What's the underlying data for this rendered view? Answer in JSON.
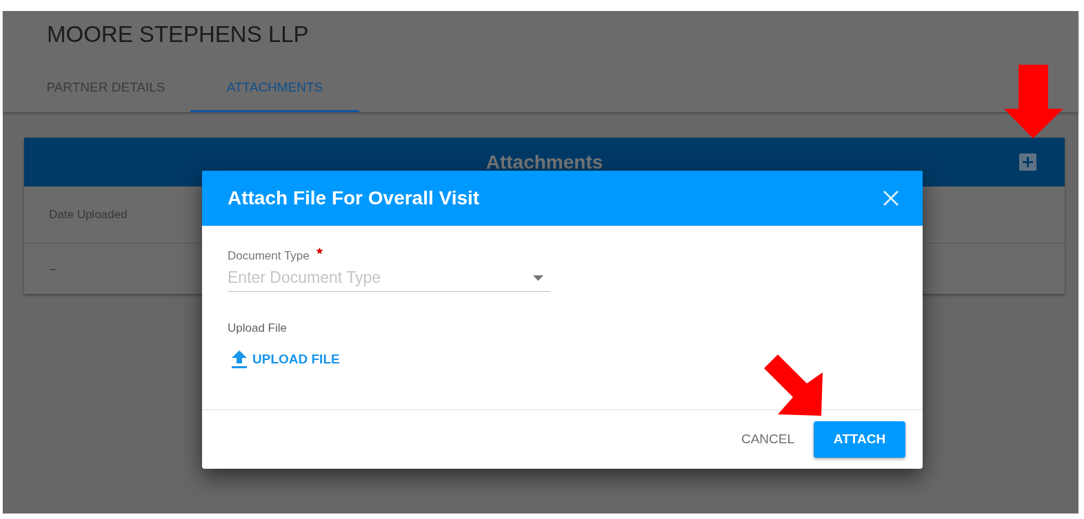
{
  "page_title": "MOORE STEPHENS LLP",
  "tabs": [
    {
      "label": "PARTNER DETAILS",
      "selected": false
    },
    {
      "label": "ATTACHMENTS",
      "selected": true
    }
  ],
  "attachments_card": {
    "title": "Attachments",
    "table": {
      "columns": [
        "Date Uploaded"
      ],
      "rows": [
        [
          "–"
        ]
      ]
    }
  },
  "dialog": {
    "title": "Attach File For Overall Visit",
    "fields": [
      {
        "kind": "select",
        "label": "Document Type",
        "required": true,
        "placeholder": "Enter Document Type"
      },
      {
        "kind": "upload",
        "label": "Upload File",
        "button": "UPLOAD FILE"
      }
    ],
    "buttons": [
      {
        "kind": "text",
        "label": "CANCEL"
      },
      {
        "kind": "primary",
        "label": "ATTACH"
      }
    ]
  }
}
